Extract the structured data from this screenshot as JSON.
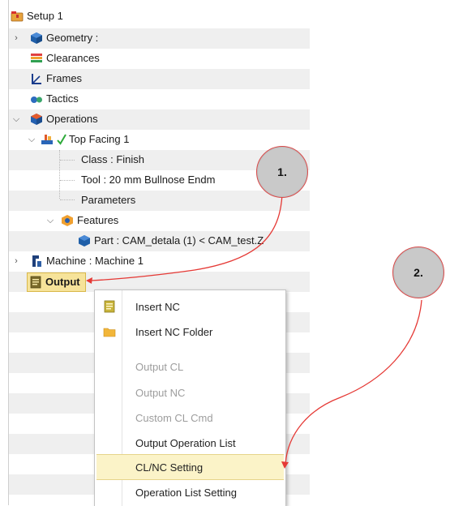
{
  "tree": {
    "setup_label": "Setup 1",
    "geometry_label": "Geometry :",
    "clearances_label": "Clearances",
    "frames_label": "Frames",
    "tactics_label": "Tactics",
    "operations_label": "Operations",
    "top_facing_label": "Top Facing 1",
    "class_label": "Class : Finish",
    "tool_label": "Tool : 20 mm Bullnose Endm",
    "parameters_label": "Parameters",
    "features_label": "Features",
    "part_label": "Part : CAM_detala (1) < CAM_test.Z",
    "machine_label": "Machine : Machine 1",
    "output_label": "Output"
  },
  "context_menu": {
    "items": [
      {
        "label": "Insert NC",
        "disabled": false,
        "icon": "nc-file-icon"
      },
      {
        "label": "Insert NC Folder",
        "disabled": false,
        "icon": "folder-icon"
      },
      {
        "label": "Output CL",
        "disabled": true
      },
      {
        "label": "Output NC",
        "disabled": true
      },
      {
        "label": "Custom CL Cmd",
        "disabled": true
      },
      {
        "label": "Output Operation List",
        "disabled": false
      },
      {
        "label": "CL/NC Setting",
        "disabled": false,
        "highlighted": true
      },
      {
        "label": "Operation List Setting",
        "disabled": false
      }
    ]
  },
  "callouts": {
    "step1": "1.",
    "step2": "2."
  },
  "colors": {
    "highlight_fill": "#f6e39a",
    "arrow": "#e53935",
    "checkmark": "#2eaa3a"
  }
}
